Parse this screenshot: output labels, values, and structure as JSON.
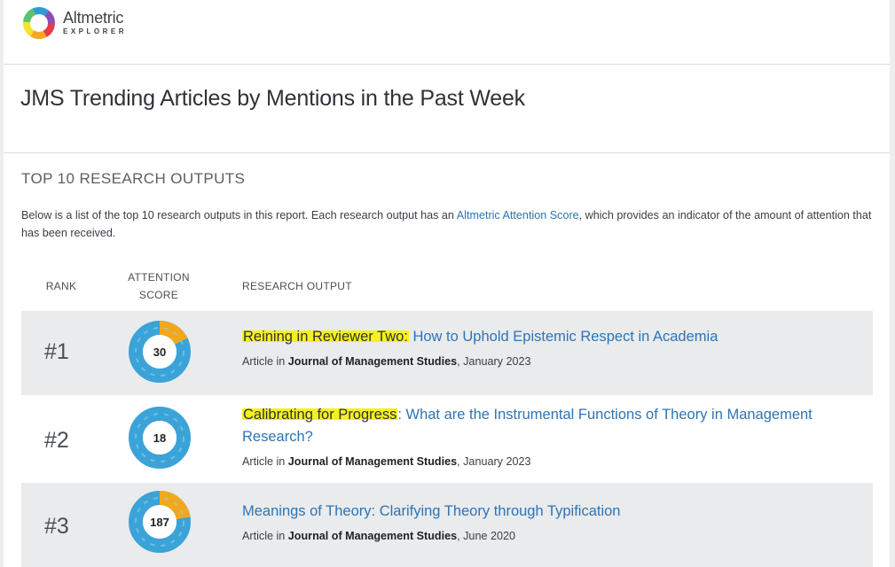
{
  "brand": {
    "name": "Altmetric",
    "sub": "EXPLORER"
  },
  "page_title": "JMS Trending Articles by Mentions in the Past Week",
  "section": {
    "heading": "TOP 10 RESEARCH OUTPUTS",
    "intro_before": "Below is a list of the top 10 research outputs in this report. Each research output has an ",
    "intro_link": "Altmetric Attention Score",
    "intro_after": ", which provides an indicator of the amount of attention that has been received."
  },
  "columns": {
    "rank": "RANK",
    "score_line1": "ATTENTION",
    "score_line2": "SCORE",
    "output": "RESEARCH OUTPUT"
  },
  "rows": [
    {
      "rank": "#1",
      "score": "30",
      "highlight": "Reining in Reviewer Two:",
      "title_rest": " How to Uphold Epistemic Respect in Academia",
      "meta_prefix": "Article in ",
      "journal": "Journal of Management Studies",
      "date": ", January 2023"
    },
    {
      "rank": "#2",
      "score": "18",
      "highlight": "Calibrating for Progress",
      "title_rest": ": What are the Instrumental Functions of Theory in Management Research?",
      "meta_prefix": "Article in ",
      "journal": "Journal of Management Studies",
      "date": ", January 2023"
    },
    {
      "rank": "#3",
      "score": "187",
      "highlight": "",
      "title_rest": "Meanings of Theory: Clarifying Theory through Typification",
      "meta_prefix": "Article in ",
      "journal": "Journal of Management Studies",
      "date": ", June 2020"
    }
  ],
  "colors": {
    "link": "#2e74b5",
    "highlight": "#f4f21c",
    "twitter_blue": "#3ba3d8",
    "news_orange": "#f2a81d",
    "row_shade": "#e9ebed"
  }
}
